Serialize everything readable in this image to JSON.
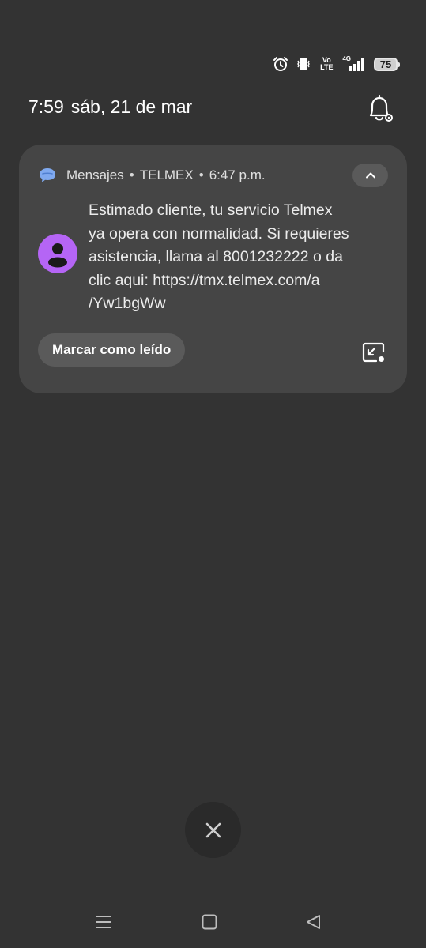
{
  "status_bar": {
    "icons": [
      "alarm-icon",
      "vibrate-icon",
      "volte-icon",
      "4g-signal-icon",
      "battery-icon"
    ],
    "vo_label": "Vo",
    "lte_label": "LTE",
    "network_label": "4G",
    "battery_level": "75"
  },
  "header": {
    "time": "7:59",
    "date": "sáb, 21 de mar"
  },
  "notification": {
    "app_name": "Mensajes",
    "separator": "•",
    "sender": "TELMEX",
    "timestamp": "6:47 p.m.",
    "message": "Estimado cliente, tu servicio Telmex\nya opera con normalidad. Si requieres\nasistencia, llama al 8001232222 o da\nclic aqui: https://tmx.telmex.com/a\n/Yw1bgWw",
    "action_mark_read": "Marcar como leído",
    "avatar_color": "#b565f5",
    "app_icon_color": "#7fa9ef"
  },
  "colors": {
    "background": "#333333",
    "card": "#454545",
    "chip": "#5a5a5a",
    "clear_button": "#2a2a2a"
  }
}
